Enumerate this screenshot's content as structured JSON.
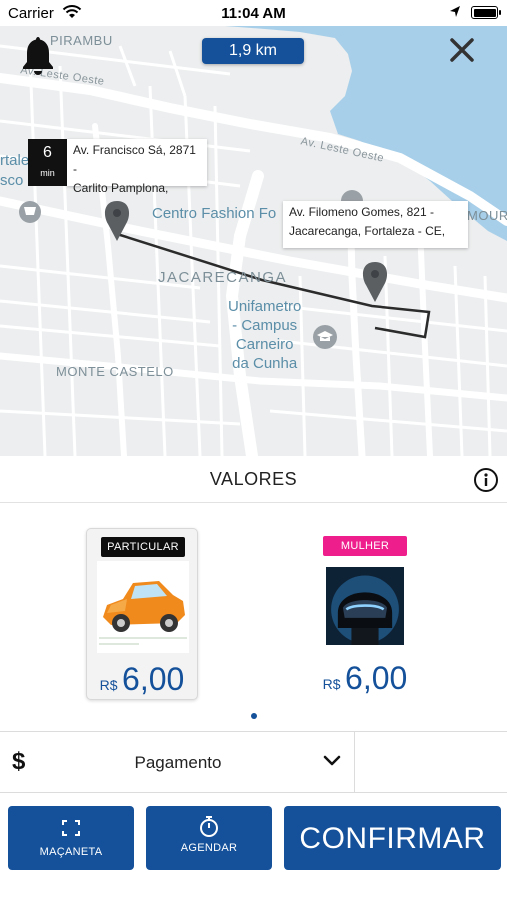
{
  "status_bar": {
    "carrier": "Carrier",
    "time": "11:04 AM"
  },
  "map": {
    "distance": "1,9 km",
    "eta": {
      "value": "6",
      "unit": "min"
    },
    "origin_address": {
      "line1": "Av. Francisco Sá, 2871 -",
      "line2": "Carlito Pamplona,"
    },
    "destination_address": {
      "line1": "Av. Filomeno Gomes, 821 -",
      "line2": "Jacarecanga, Fortaleza - CE,"
    },
    "labels": {
      "pirambu": "PIRAMBU",
      "leste_oeste_1": "Av. Leste Oeste",
      "leste_oeste_2": "Av. Leste Oeste",
      "centro_fashion": "Centro Fashion Fo",
      "jacarecanga": "JACARECANGA",
      "unifametro": "Unifametro\n- Campus\nCarneiro\nda Cunha",
      "monte_castelo": "MONTE CASTELO",
      "mour": "MOUR",
      "left_fragment": "rtaleza\nsco"
    },
    "colors": {
      "water": "#a7cfe9",
      "road": "#ffffff",
      "land": "#eceeef",
      "route": "#2b2b2b",
      "pin": "#5b5f62"
    }
  },
  "values": {
    "title": "VALORES",
    "info_icon": "info-icon"
  },
  "cards": [
    {
      "tag": "PARTICULAR",
      "currency": "R$",
      "price": "6,00",
      "selected": true,
      "image": "orange-car"
    },
    {
      "tag": "MULHER",
      "currency": "R$",
      "price": "6,00",
      "selected": false,
      "image": "motorcycle-helmet"
    }
  ],
  "payment": {
    "symbol": "$",
    "label": "Pagamento"
  },
  "buttons": {
    "macaneta": "MAÇANETA",
    "agendar": "AGENDAR",
    "confirmar": "CONFIRMAR"
  },
  "theme": {
    "primary": "#14519a",
    "pink_tag": "#ee1e8c"
  }
}
